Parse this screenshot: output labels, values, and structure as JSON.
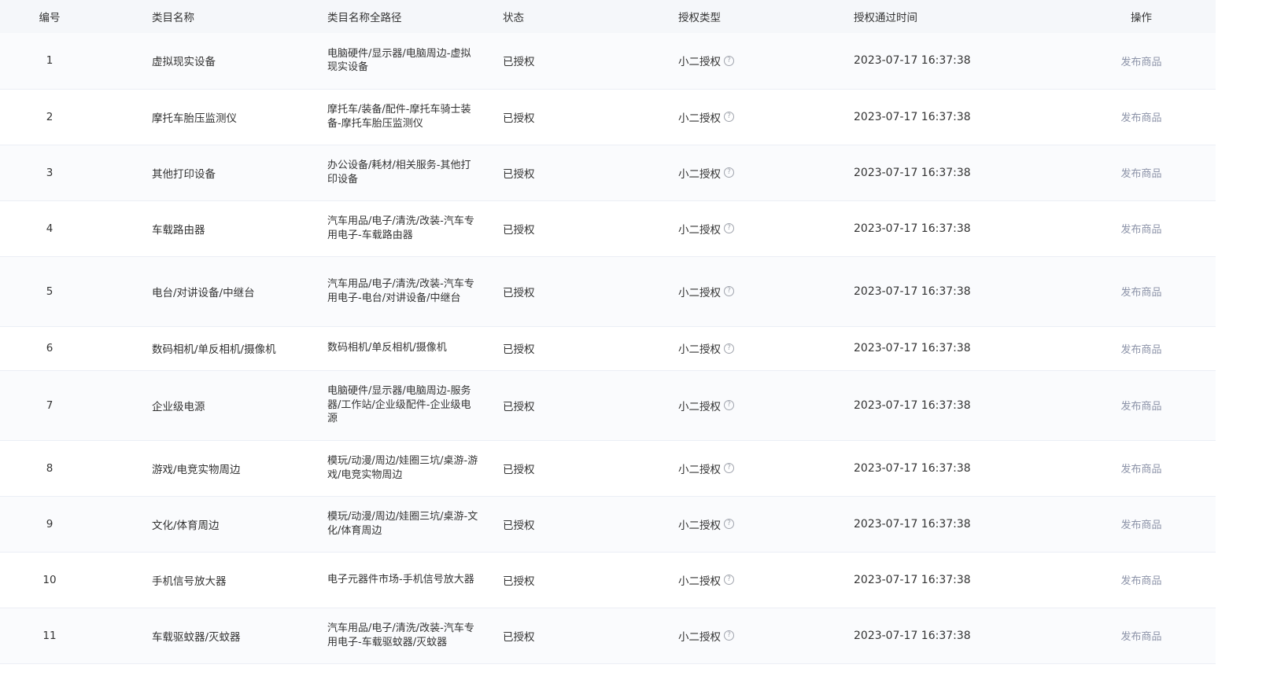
{
  "headers": {
    "id": "编号",
    "name": "类目名称",
    "path": "类目名称全路径",
    "status": "状态",
    "auth_type": "授权类型",
    "auth_time": "授权通过时间",
    "action": "操作"
  },
  "rows": [
    {
      "id": "1",
      "name": "虚拟现实设备",
      "path": "电脑硬件/显示器/电脑周边-虚拟现实设备",
      "status": "已授权",
      "auth_type": "小二授权",
      "auth_time": "2023-07-17 16:37:38",
      "action": "发布商品"
    },
    {
      "id": "2",
      "name": "摩托车胎压监测仪",
      "path": "摩托车/装备/配件-摩托车骑士装备-摩托车胎压监测仪",
      "status": "已授权",
      "auth_type": "小二授权",
      "auth_time": "2023-07-17 16:37:38",
      "action": "发布商品"
    },
    {
      "id": "3",
      "name": "其他打印设备",
      "path": "办公设备/耗材/相关服务-其他打印设备",
      "status": "已授权",
      "auth_type": "小二授权",
      "auth_time": "2023-07-17 16:37:38",
      "action": "发布商品"
    },
    {
      "id": "4",
      "name": "车载路由器",
      "path": "汽车用品/电子/清洗/改装-汽车专用电子-车载路由器",
      "status": "已授权",
      "auth_type": "小二授权",
      "auth_time": "2023-07-17 16:37:38",
      "action": "发布商品"
    },
    {
      "id": "5",
      "name": "电台/对讲设备/中继台",
      "path": "汽车用品/电子/清洗/改装-汽车专用电子-电台/对讲设备/中继台",
      "status": "已授权",
      "auth_type": "小二授权",
      "auth_time": "2023-07-17 16:37:38",
      "action": "发布商品"
    },
    {
      "id": "6",
      "name": "数码相机/单反相机/摄像机",
      "path": "数码相机/单反相机/摄像机",
      "status": "已授权",
      "auth_type": "小二授权",
      "auth_time": "2023-07-17 16:37:38",
      "action": "发布商品"
    },
    {
      "id": "7",
      "name": "企业级电源",
      "path": "电脑硬件/显示器/电脑周边-服务器/工作站/企业级配件-企业级电源",
      "status": "已授权",
      "auth_type": "小二授权",
      "auth_time": "2023-07-17 16:37:38",
      "action": "发布商品"
    },
    {
      "id": "8",
      "name": "游戏/电竞实物周边",
      "path": "模玩/动漫/周边/娃圈三坑/桌游-游戏/电竞实物周边",
      "status": "已授权",
      "auth_type": "小二授权",
      "auth_time": "2023-07-17 16:37:38",
      "action": "发布商品"
    },
    {
      "id": "9",
      "name": "文化/体育周边",
      "path": "模玩/动漫/周边/娃圈三坑/桌游-文化/体育周边",
      "status": "已授权",
      "auth_type": "小二授权",
      "auth_time": "2023-07-17 16:37:38",
      "action": "发布商品"
    },
    {
      "id": "10",
      "name": "手机信号放大器",
      "path": "电子元器件市场-手机信号放大器",
      "status": "已授权",
      "auth_type": "小二授权",
      "auth_time": "2023-07-17 16:37:38",
      "action": "发布商品"
    },
    {
      "id": "11",
      "name": "车载驱蚊器/灭蚊器",
      "path": "汽车用品/电子/清洗/改装-汽车专用电子-车载驱蚊器/灭蚊器",
      "status": "已授权",
      "auth_type": "小二授权",
      "auth_time": "2023-07-17 16:37:38",
      "action": "发布商品"
    }
  ],
  "icons": {
    "help": "question-circle-icon"
  },
  "colors": {
    "header_bg": "#f5f7fa",
    "link": "#8c93a8",
    "border": "#ebeef5"
  }
}
